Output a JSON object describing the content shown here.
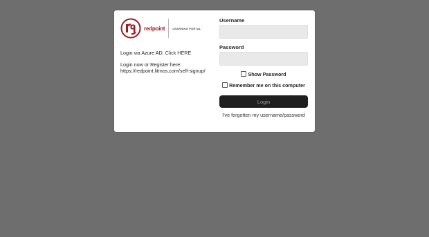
{
  "branding": {
    "logo_mark": "rg",
    "wordmark": "redpoint",
    "tagline": "LEARNING PORTAL",
    "brand_color": "#9a1b1e"
  },
  "left": {
    "azure_prefix": "Login via Azure AD: ",
    "azure_link": "Click HERE",
    "register_line1": "Login now or Register here:",
    "register_line2": "https://redpoint.litmos.com/self-signup/"
  },
  "form": {
    "username_label": "Username",
    "username_value": "",
    "password_label": "Password",
    "password_value": "",
    "show_password_label": "Show Password",
    "remember_label": "Remember me on this computer",
    "login_button": "Login",
    "forgot_link": "I've forgotten my username/password"
  },
  "colors": {
    "background": "#6e6e6e",
    "card": "#ffffff",
    "button": "#1f1f1f",
    "input": "#e9e9e9"
  }
}
